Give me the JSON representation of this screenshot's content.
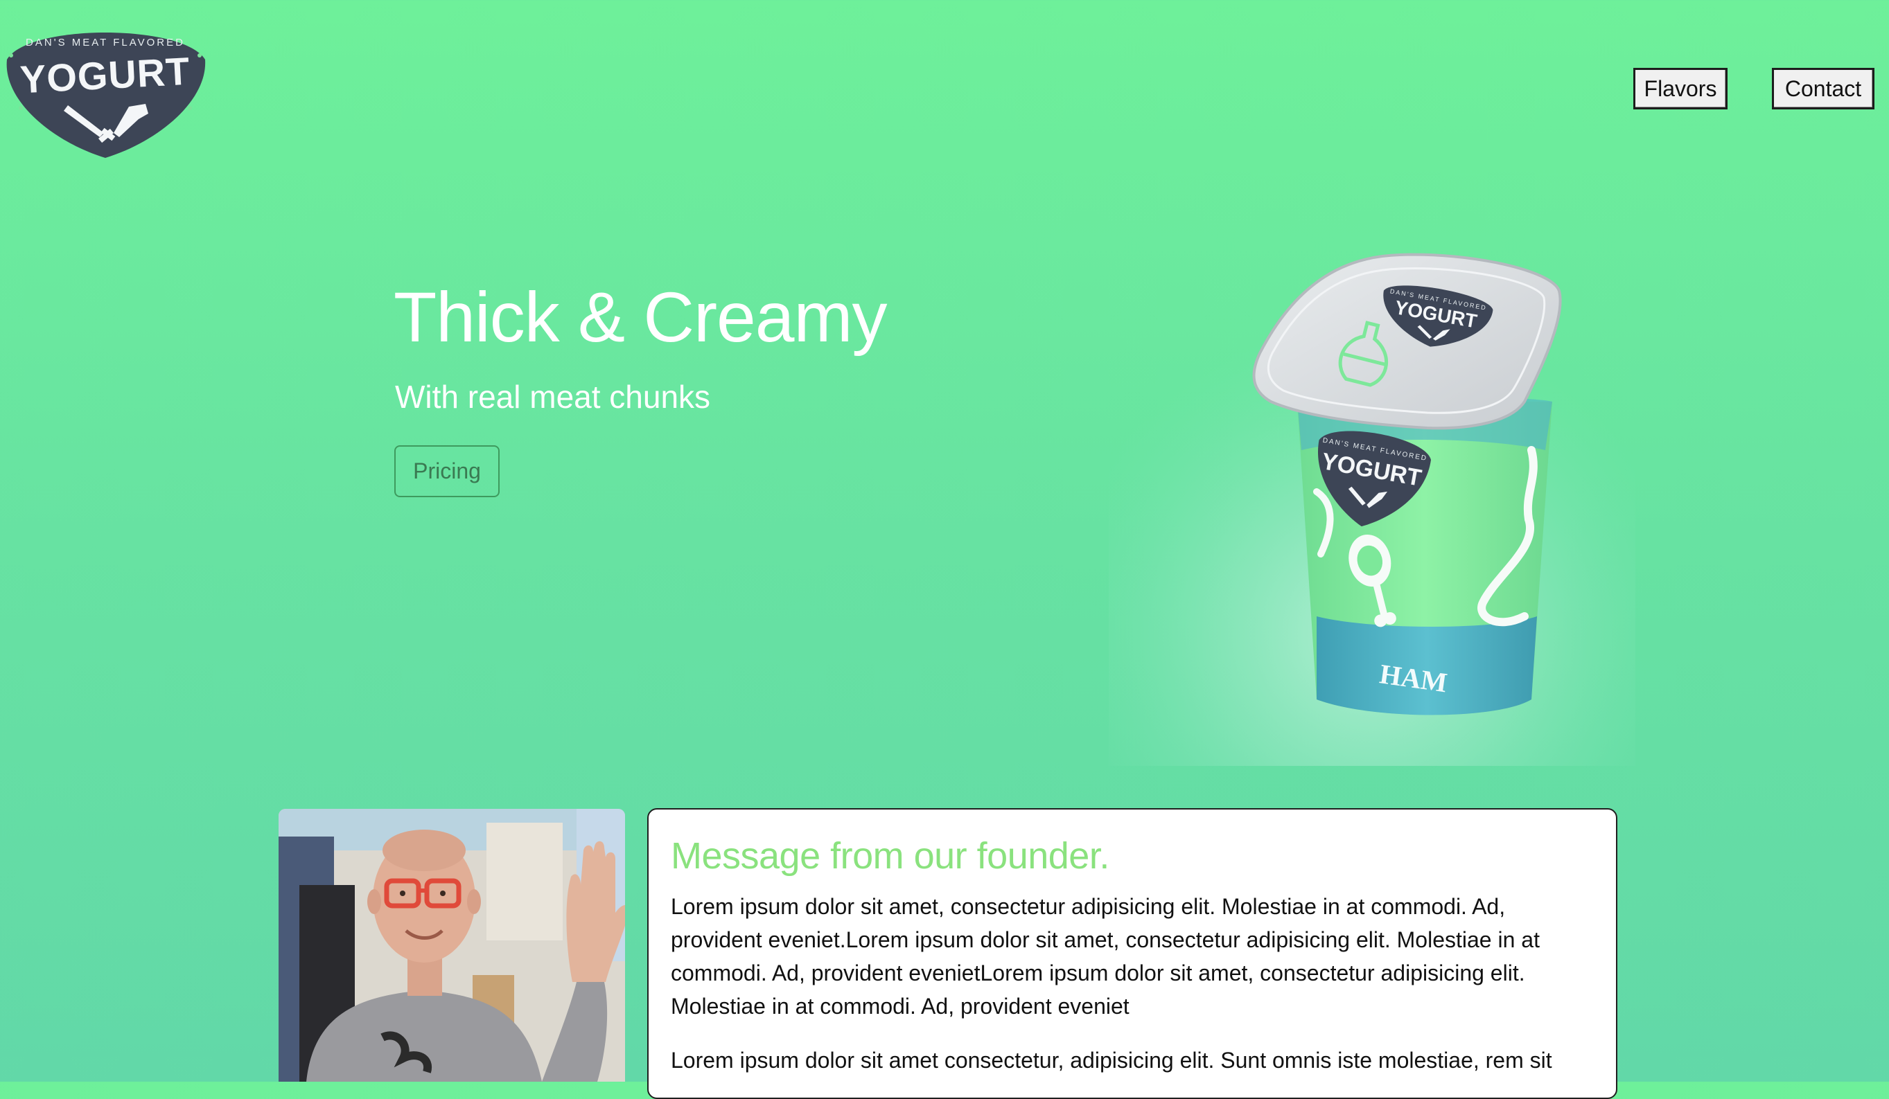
{
  "logo": {
    "top_text": "DAN'S MEAT FLAVORED",
    "brand": "YOGURT"
  },
  "nav": {
    "flavors_label": "Flavors",
    "contact_label": "Contact"
  },
  "hero": {
    "title": "Thick & Creamy",
    "subtitle": "With real meat chunks",
    "pricing_label": "Pricing"
  },
  "product": {
    "lid_brand": "YOGURT",
    "lid_top_text": "DAN'S MEAT FLAVORED",
    "cup_brand": "YOGURT",
    "cup_top_text": "DAN'S MEAT FLAVORED",
    "flavor": "HAM"
  },
  "founder": {
    "title": "Message from our founder.",
    "paragraphs": [
      "Lorem ipsum dolor sit amet, consectetur adipisicing elit. Molestiae in at commodi. Ad, provident eveniet.Lorem ipsum dolor sit amet, consectetur adipisicing elit. Molestiae in at commodi. Ad, provident evenietLorem ipsum dolor sit amet, consectetur adipisicing elit. Molestiae in at commodi. Ad, provident eveniet",
      "Lorem ipsum dolor sit amet consectetur, adipisicing elit. Sunt omnis iste molestiae, rem sit"
    ]
  },
  "colors": {
    "background_top": "#6ef09a",
    "background_bottom": "#62d8a8",
    "logo_badge": "#3d4556",
    "title_accent": "#8ae27e",
    "cup_green": "#7df09a",
    "cup_blue": "#56b8c8"
  },
  "icons": {
    "logo_knives": "crossed-knives-icon",
    "lid_bottle": "bottle-icon",
    "cup_ham": "ham-leg-icon"
  }
}
